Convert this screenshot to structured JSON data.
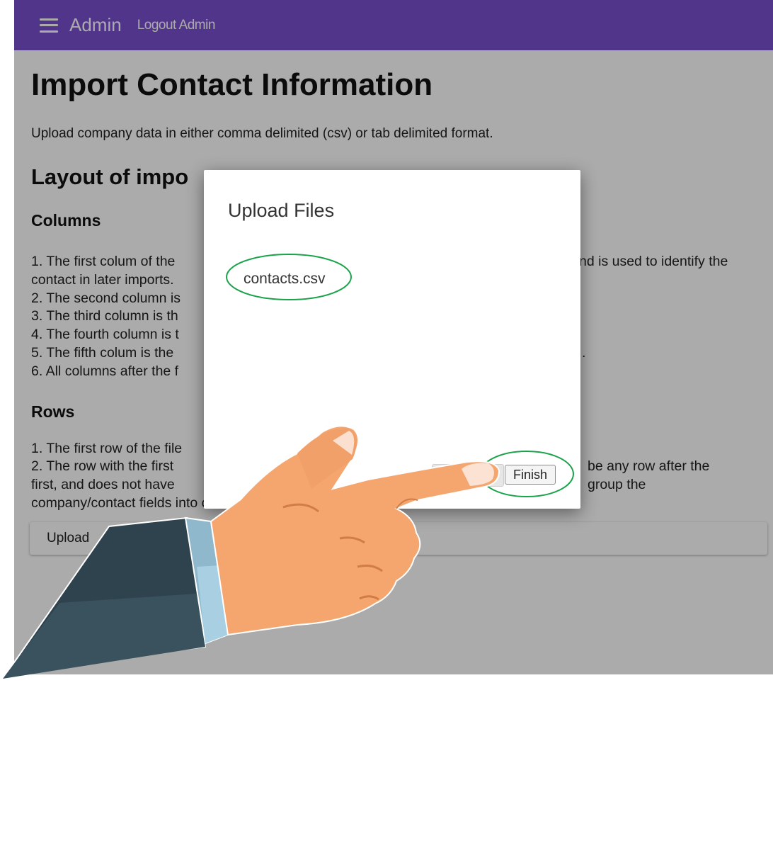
{
  "topbar": {
    "menu_icon": "hamburger-menu-icon",
    "app_title": "Admin",
    "logout_link": "Logout Admin",
    "color": "#7a4fd0"
  },
  "page": {
    "title": "Import Contact Information",
    "intro": "Upload company data in either comma delimited (csv) or tab delimited format.",
    "layout_heading": "Layout of impo",
    "columns_heading": "Columns",
    "column_lines": [
      "1. The first colum of the",
      "contact in later imports.",
      "2. The second column is",
      "3. The third column is th",
      "4. The fourth column is t",
      "5. The fifth colum is the",
      "6. All columns after the f"
    ],
    "column_line1_right": "nd is used to identify the",
    "column_line6_right": ".",
    "rows_heading": "Rows",
    "row_lines": [
      "1. The first row of the file",
      "2. The row with the first",
      "first, and does not have",
      "company/contact fields into ca"
    ],
    "row_line2_right": "be any row after the",
    "row_line3_right": "group the",
    "upload_button": "Upload"
  },
  "dialog": {
    "title": "Upload Files",
    "file_name": "contacts.csv",
    "prev_button_fragment": "s",
    "finish_button": "Finish"
  },
  "annotations": {
    "highlight_color": "#1aa34a",
    "overlay": "pointing-hand-illustration"
  }
}
